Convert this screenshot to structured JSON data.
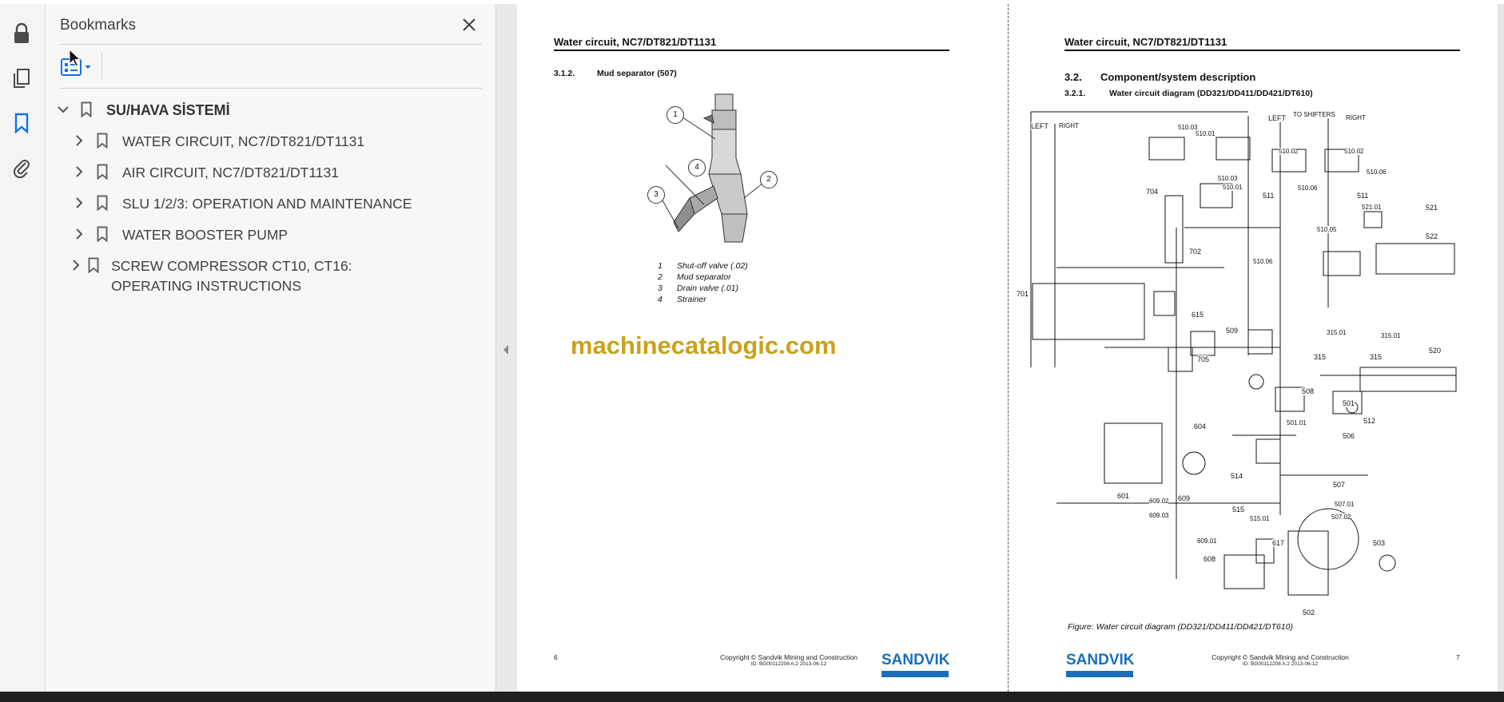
{
  "rail": {
    "icons": [
      "lock-icon",
      "pages-icon",
      "bookmark-icon",
      "attachment-icon"
    ]
  },
  "bookmarks_panel": {
    "title": "Bookmarks",
    "items": [
      {
        "label": "SU/HAVA SİSTEMİ",
        "level": 0,
        "expanded": true
      },
      {
        "label": "WATER CIRCUIT, NC7/DT821/DT1131",
        "level": 1
      },
      {
        "label": "AIR CIRCUIT, NC7/DT821/DT1131",
        "level": 1
      },
      {
        "label": "SLU 1/2/3: OPERATION AND MAINTENANCE",
        "level": 1
      },
      {
        "label": "WATER BOOSTER PUMP",
        "level": 1
      },
      {
        "label": "SCREW COMPRESSOR CT10, CT16: OPERATING INSTRUCTIONS",
        "level": 1
      }
    ]
  },
  "page_left": {
    "header": "Water circuit, NC7/DT821/DT1131",
    "section_num": "3.1.2.",
    "section_title": "Mud separator (507)",
    "callouts": [
      "1",
      "2",
      "3",
      "4"
    ],
    "legend": [
      {
        "num": "1",
        "text": "Shut-off valve (.02)"
      },
      {
        "num": "2",
        "text": "Mud separator"
      },
      {
        "num": "3",
        "text": "Drain valve (.01)"
      },
      {
        "num": "4",
        "text": "Strainer"
      }
    ],
    "watermark": "machinecatalogic.com",
    "page_number": "6",
    "copyright": "Copyright © Sandvik Mining and Construction",
    "doc_id": "ID: BG00112208 A.2 2013-06-12",
    "logo": "SANDVIK"
  },
  "page_right": {
    "header": "Water circuit, NC7/DT821/DT1131",
    "section_num": "3.2.",
    "section_title": "Component/system description",
    "sub_num": "3.2.1.",
    "sub_title": "Water circuit diagram (DD321/DD411/DD421/DT610)",
    "diagram_labels": [
      "LEFT",
      "RIGHT",
      "LEFT",
      "TO SHIFTERS",
      "RIGHT",
      "510.03",
      "510.01",
      "510.02",
      "510.02",
      "510.03",
      "510.01",
      "510.06",
      "510.06",
      "704",
      "511",
      "511",
      "521.01",
      "521",
      "510.05",
      "522",
      "702",
      "510.06",
      "701",
      "615",
      "509",
      "315.01",
      "315.01",
      "315",
      "315",
      "520",
      "705",
      "508",
      "501",
      "501.01",
      "512",
      "604",
      "506",
      "514",
      "507",
      "601",
      "609.02",
      "609",
      "507.01",
      "609.03",
      "515",
      "515.01",
      "507.02",
      "609.01",
      "617",
      "503",
      "608",
      "502"
    ],
    "figure_caption": "Figure: Water circuit diagram (DD321/DD411/DD421/DT610)",
    "page_number": "7",
    "copyright": "Copyright © Sandvik Mining and Construction",
    "doc_id": "ID: BG00112208 A.2 2013-06-12",
    "logo": "SANDVIK"
  },
  "colors": {
    "accent": "#1473e6",
    "watermark": "#c8a21a",
    "sandvik_blue": "#1a6fb8"
  }
}
